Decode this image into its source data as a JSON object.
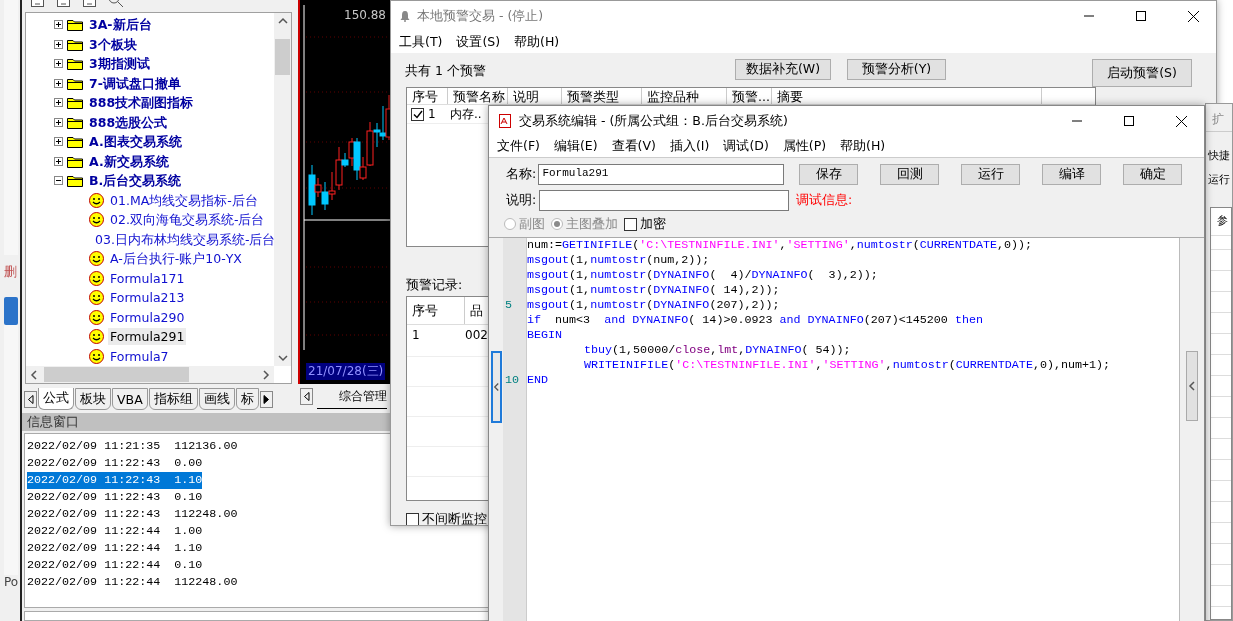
{
  "left_strip": {
    "texts": [
      "删",
      "Po"
    ]
  },
  "formula_tree": {
    "items": [
      {
        "label": "3A-新后台",
        "expanded": false
      },
      {
        "label": "3个板块",
        "expanded": false
      },
      {
        "label": "3期指测试",
        "expanded": false
      },
      {
        "label": "7-调试盘口撤单",
        "expanded": false
      },
      {
        "label": "888技术副图指标",
        "expanded": false
      },
      {
        "label": "888选股公式",
        "expanded": false
      },
      {
        "label": "A.图表交易系统",
        "expanded": false
      },
      {
        "label": "A.新交易系统",
        "expanded": false
      },
      {
        "label": "B.后台交易系统",
        "expanded": true,
        "children": [
          {
            "label": "01.MA均线交易指标-后台",
            "selected": false
          },
          {
            "label": "02.双向海龟交易系统-后台",
            "selected": false
          },
          {
            "label": "03.日内布林均线交易系统-后台",
            "selected": false
          },
          {
            "label": "A-后台执行-账户10-YX",
            "selected": false
          },
          {
            "label": "Formula171",
            "selected": false
          },
          {
            "label": "Formula213",
            "selected": false
          },
          {
            "label": "Formula290",
            "selected": false
          },
          {
            "label": "Formula291",
            "selected": true
          },
          {
            "label": "Formula7",
            "selected": false
          }
        ]
      }
    ]
  },
  "left_tabs": [
    {
      "label": "公式",
      "selected": true
    },
    {
      "label": "板块",
      "selected": false
    },
    {
      "label": "VBA",
      "selected": false
    },
    {
      "label": "指标组",
      "selected": false
    },
    {
      "label": "画线",
      "selected": false
    },
    {
      "label": "标",
      "selected": false
    }
  ],
  "chart": {
    "price_label": "150.88",
    "date_label": "21/07/28(三)",
    "tab": "综合管理"
  },
  "info_window": {
    "title": "信息窗口",
    "lines": [
      {
        "text": "2022/02/09 11:21:35  112136.00",
        "selected": false
      },
      {
        "text": "2022/02/09 11:22:43  0.00",
        "selected": false
      },
      {
        "text": "2022/02/09 11:22:43  1.10",
        "selected": true
      },
      {
        "text": "2022/02/09 11:22:43  0.10",
        "selected": false
      },
      {
        "text": "2022/02/09 11:22:43  112248.00",
        "selected": false
      },
      {
        "text": "2022/02/09 11:22:44  1.00",
        "selected": false
      },
      {
        "text": "2022/02/09 11:22:44  1.10",
        "selected": false
      },
      {
        "text": "2022/02/09 11:22:44  0.10",
        "selected": false
      },
      {
        "text": "2022/02/09 11:22:44  112248.00",
        "selected": false
      }
    ]
  },
  "alert_window": {
    "title": "本地预警交易 - (停止)",
    "menu": [
      "工具(T)",
      "设置(S)",
      "帮助(H)"
    ],
    "summary": "共有 1 个预警",
    "buttons": [
      "数据补充(W)",
      "预警分析(Y)"
    ],
    "start_button": "启动预警(S)",
    "table": {
      "columns": [
        "序号",
        "预警名称",
        "说明",
        "预警类型",
        "监控品种",
        "预警...",
        "摘要"
      ],
      "rows": [
        {
          "checked": true,
          "cells": [
            "1",
            "内存.."
          ]
        }
      ]
    },
    "records_label": "预警记录:",
    "records_table": {
      "columns": [
        "序号",
        "品"
      ],
      "rows": [
        [
          "1",
          "002"
        ]
      ]
    },
    "continuous_monitor": {
      "label": "不间断监控",
      "checked": false
    }
  },
  "editor": {
    "title": "交易系统编辑 - (所属公式组：B.后台交易系统)",
    "menu": [
      "文件(F)",
      "编辑(E)",
      "查看(V)",
      "插入(I)",
      "调试(D)",
      "属性(P)",
      "帮助(H)"
    ],
    "name_label": "名称:",
    "name_value": "Formula291",
    "desc_label": "说明:",
    "debug_label": "调试信息:",
    "buttons": [
      "保存",
      "回测",
      "运行",
      "编译",
      "确定"
    ],
    "options": [
      {
        "kind": "radio",
        "label": "副图",
        "selected": false,
        "disabled": true
      },
      {
        "kind": "radio",
        "label": "主图叠加",
        "selected": true,
        "disabled": true
      },
      {
        "kind": "checkbox",
        "label": "加密",
        "checked": false
      }
    ],
    "code": [
      {
        "tokens": [
          {
            "kind": "plain",
            "text": "num:="
          },
          {
            "kind": "function",
            "text": "GETINIFILE"
          },
          {
            "kind": "plain",
            "text": "("
          },
          {
            "kind": "string",
            "text": "'C:\\TESTNINFILE.INI'"
          },
          {
            "kind": "plain",
            "text": ","
          },
          {
            "kind": "string",
            "text": "'SETTING'"
          },
          {
            "kind": "plain",
            "text": ","
          },
          {
            "kind": "function",
            "text": "numtostr"
          },
          {
            "kind": "plain",
            "text": "("
          },
          {
            "kind": "function",
            "text": "CURRENTDATE"
          },
          {
            "kind": "plain",
            "text": ",0));"
          }
        ]
      },
      {
        "tokens": [
          {
            "kind": "function",
            "text": "msgout"
          },
          {
            "kind": "plain",
            "text": "(1,"
          },
          {
            "kind": "function",
            "text": "numtostr"
          },
          {
            "kind": "plain",
            "text": "(num,2));"
          }
        ]
      },
      {
        "tokens": [
          {
            "kind": "function",
            "text": "msgout"
          },
          {
            "kind": "plain",
            "text": "(1,"
          },
          {
            "kind": "function",
            "text": "numtostr"
          },
          {
            "kind": "plain",
            "text": "("
          },
          {
            "kind": "function",
            "text": "DYNAINFO"
          },
          {
            "kind": "plain",
            "text": "(  4)/"
          },
          {
            "kind": "function",
            "text": "DYNAINFO"
          },
          {
            "kind": "plain",
            "text": "(  3),2));"
          }
        ]
      },
      {
        "tokens": [
          {
            "kind": "function",
            "text": "msgout"
          },
          {
            "kind": "plain",
            "text": "(1,"
          },
          {
            "kind": "function",
            "text": "numtostr"
          },
          {
            "kind": "plain",
            "text": "("
          },
          {
            "kind": "function",
            "text": "DYNAINFO"
          },
          {
            "kind": "plain",
            "text": "( 14),2));"
          }
        ]
      },
      {
        "number": "5",
        "tokens": [
          {
            "kind": "function",
            "text": "msgout"
          },
          {
            "kind": "plain",
            "text": "(1,"
          },
          {
            "kind": "function",
            "text": "numtostr"
          },
          {
            "kind": "plain",
            "text": "("
          },
          {
            "kind": "function",
            "text": "DYNAINFO"
          },
          {
            "kind": "plain",
            "text": "(207),2));"
          }
        ]
      },
      {
        "tokens": [
          {
            "kind": "function",
            "text": "if"
          },
          {
            "kind": "plain",
            "text": "  num<3  "
          },
          {
            "kind": "function",
            "text": "and"
          },
          {
            "kind": "function",
            "text": " DYNAINFO"
          },
          {
            "kind": "plain",
            "text": "( 14)>0.0923 "
          },
          {
            "kind": "function",
            "text": "and"
          },
          {
            "kind": "function",
            "text": " DYNAINFO"
          },
          {
            "kind": "plain",
            "text": "(207)<145200 "
          },
          {
            "kind": "function",
            "text": "then"
          }
        ]
      },
      {
        "tokens": [
          {
            "kind": "function",
            "text": "BEGIN"
          }
        ]
      },
      {
        "indented": true,
        "tokens": [
          {
            "kind": "function",
            "text": "tbuy"
          },
          {
            "kind": "plain",
            "text": "(1,50000/"
          },
          {
            "kind": "variable",
            "text": "close"
          },
          {
            "kind": "plain",
            "text": ","
          },
          {
            "kind": "variable",
            "text": "lmt"
          },
          {
            "kind": "plain",
            "text": ","
          },
          {
            "kind": "function",
            "text": "DYNAINFO"
          },
          {
            "kind": "plain",
            "text": "( 54));"
          }
        ]
      },
      {
        "indented": true,
        "tokens": [
          {
            "kind": "function",
            "text": "WRITEINIFILE"
          },
          {
            "kind": "plain",
            "text": "("
          },
          {
            "kind": "string",
            "text": "'C:\\TESTNINFILE.INI'"
          },
          {
            "kind": "plain",
            "text": ","
          },
          {
            "kind": "string",
            "text": "'SETTING'"
          },
          {
            "kind": "plain",
            "text": ","
          },
          {
            "kind": "function",
            "text": "numtostr"
          },
          {
            "kind": "plain",
            "text": "("
          },
          {
            "kind": "function",
            "text": "CURRENTDATE"
          },
          {
            "kind": "plain",
            "text": ",0),num+1);"
          }
        ]
      },
      {
        "number": "10",
        "tokens": [
          {
            "kind": "function",
            "text": "END"
          }
        ]
      }
    ]
  },
  "right_window": {
    "title": "扩",
    "labels": [
      "快捷",
      "运行"
    ],
    "column": "参"
  }
}
